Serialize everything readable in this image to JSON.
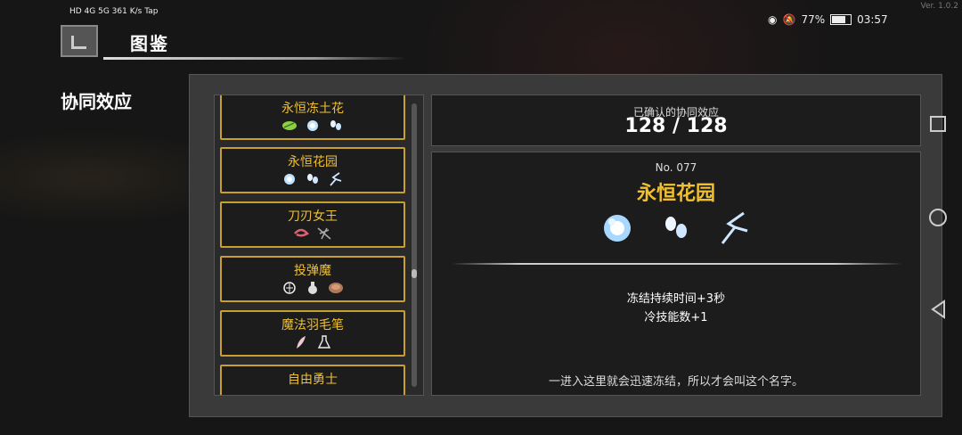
{
  "status_bar": {
    "left_text": "HD 4G 5G 361 K/s Tap",
    "battery": "77%",
    "time": "03:57",
    "version": "Ver. 1.0.2"
  },
  "header": {
    "title": "图鉴"
  },
  "section_label": "协同效应",
  "list": {
    "items": [
      {
        "name": "永恒冻土花",
        "icons": [
          "leaf-icon",
          "ice-flower-icon",
          "frost-petals-icon"
        ]
      },
      {
        "name": "永恒花园",
        "icons": [
          "ice-flower-icon",
          "frost-petals-icon",
          "lightning-branch-icon"
        ]
      },
      {
        "name": "刀刃女王",
        "icons": [
          "shrimp-icon",
          "claw-icon"
        ]
      },
      {
        "name": "投弹魔",
        "icons": [
          "bomb-emblem-icon",
          "flask-icon",
          "bread-icon"
        ]
      },
      {
        "name": "魔法羽毛笔",
        "icons": [
          "feather-icon",
          "potion-icon"
        ]
      },
      {
        "name": "自由勇士",
        "icons": []
      }
    ]
  },
  "summary": {
    "label": "已确认的协同效应",
    "value": "128 / 128"
  },
  "detail": {
    "number": "No. 077",
    "name": "永恒花园",
    "icons": [
      "ice-flower-icon",
      "frost-petals-icon",
      "lightning-branch-icon"
    ],
    "effects": [
      "冻结持续时间+3秒",
      "冷技能数+1"
    ],
    "flavor": "一进入这里就会迅速冻结，所以才会叫这个名字。"
  },
  "colors": {
    "accent": "#f0c030",
    "item_border": "#c8a030",
    "panel": "#3a3a3a"
  }
}
